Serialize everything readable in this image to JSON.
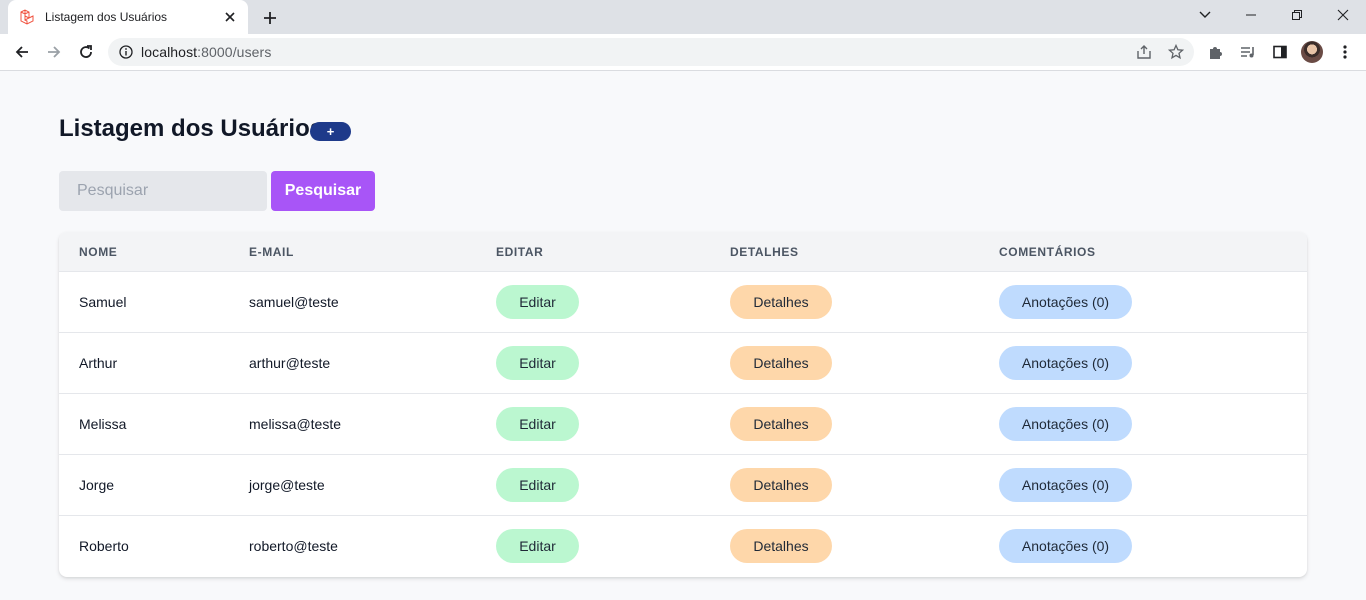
{
  "browser": {
    "tab_title": "Listagem dos Usuários",
    "url_host": "localhost",
    "url_port_path": ":8000/users"
  },
  "page": {
    "title": "Listagem dos Usuários",
    "add_label": "+"
  },
  "search": {
    "placeholder": "Pesquisar",
    "value": "",
    "button_label": "Pesquisar"
  },
  "table": {
    "headers": {
      "name": "NOME",
      "email": "E-MAIL",
      "edit": "EDITAR",
      "details": "DETALHES",
      "comments": "COMENTÁRIOS"
    },
    "rows": [
      {
        "name": "Samuel",
        "email": "samuel@teste",
        "edit": "Editar",
        "details": "Detalhes",
        "notes": "Anotações (0)"
      },
      {
        "name": "Arthur",
        "email": "arthur@teste",
        "edit": "Editar",
        "details": "Detalhes",
        "notes": "Anotações (0)"
      },
      {
        "name": "Melissa",
        "email": "melissa@teste",
        "edit": "Editar",
        "details": "Detalhes",
        "notes": "Anotações (0)"
      },
      {
        "name": "Jorge",
        "email": "jorge@teste",
        "edit": "Editar",
        "details": "Detalhes",
        "notes": "Anotações (0)"
      },
      {
        "name": "Roberto",
        "email": "roberto@teste",
        "edit": "Editar",
        "details": "Detalhes",
        "notes": "Anotações (0)"
      }
    ]
  },
  "colors": {
    "add_button": "#1e3a8a",
    "search_button": "#a855f7",
    "edit_pill": "#bbf7d0",
    "details_pill": "#fed7aa",
    "notes_pill": "#bfdbfe"
  },
  "icons": {
    "favicon": "laravel-logo-icon",
    "back": "arrow-left-icon",
    "forward": "arrow-right-icon",
    "reload": "reload-icon",
    "site_info": "info-circle-icon",
    "share": "share-icon",
    "bookmark": "star-icon",
    "extensions": "puzzle-icon",
    "media": "playlist-icon",
    "side_panel": "side-panel-icon",
    "menu": "kebab-menu-icon"
  }
}
